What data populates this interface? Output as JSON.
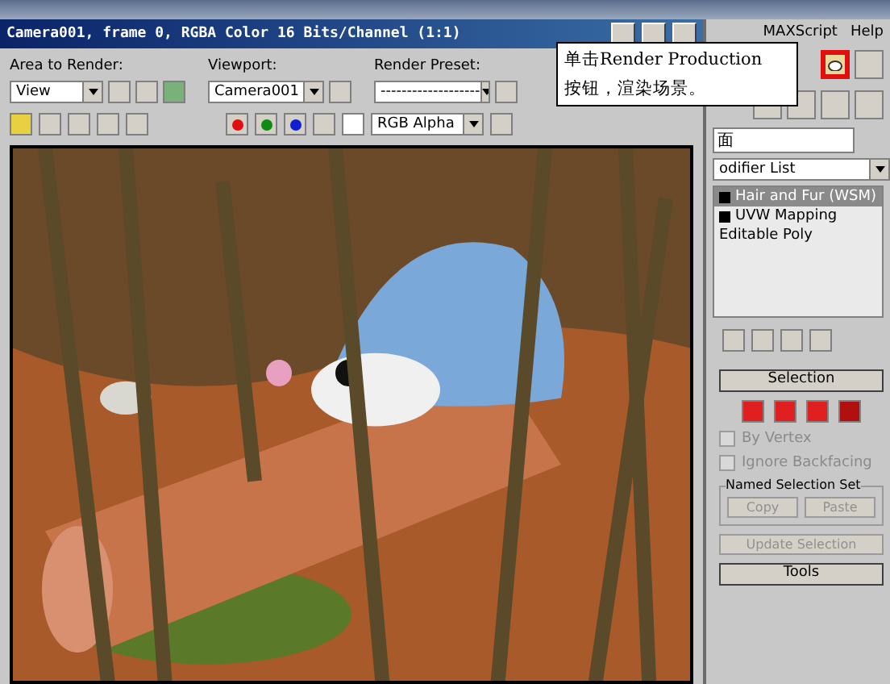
{
  "render_window": {
    "title": "Camera001, frame 0, RGBA Color 16 Bits/Channel (1:1)",
    "area_to_render": {
      "label": "Area to Render:",
      "value": "View"
    },
    "viewport": {
      "label": "Viewport:",
      "value": "Camera001"
    },
    "render_preset": {
      "label": "Render Preset:",
      "value": "-------------------"
    },
    "channel_display": "RGB Alpha"
  },
  "menu": [
    "MAXScript",
    "Help"
  ],
  "object_name": "面",
  "modifier_list": "odifier List",
  "stack": [
    {
      "label": "Hair and Fur (WSM)",
      "selected": true,
      "expandable": true
    },
    {
      "label": "UVW Mapping",
      "selected": false,
      "expandable": true
    },
    {
      "label": "Editable Poly",
      "selected": false,
      "expandable": false
    }
  ],
  "selection": {
    "title": "Selection",
    "options": [
      {
        "label": "By Vertex",
        "checked": false,
        "disabled": true
      },
      {
        "label": "Ignore Backfacing",
        "checked": false,
        "disabled": true
      }
    ],
    "named_set": {
      "title": "Named Selection Set",
      "buttons": [
        {
          "label": "Copy",
          "disabled": true
        },
        {
          "label": "Paste",
          "disabled": true
        }
      ]
    },
    "update_button": {
      "label": "Update Selection",
      "disabled": true
    }
  },
  "tools_title": "Tools",
  "callout": {
    "lines": [
      "单击Render Production",
      "按钮，渲染场景。"
    ]
  }
}
